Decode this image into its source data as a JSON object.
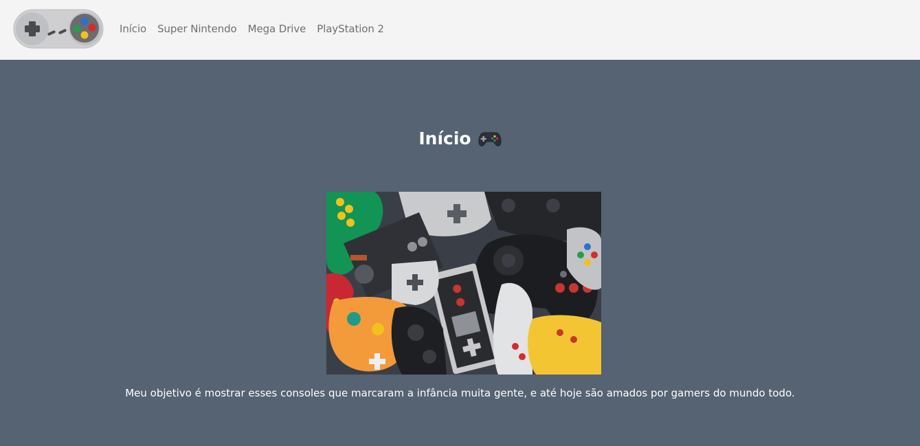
{
  "nav": {
    "items": [
      {
        "label": "Início"
      },
      {
        "label": "Super Nintendo"
      },
      {
        "label": "Mega Drive"
      },
      {
        "label": "PlayStation 2"
      }
    ]
  },
  "main": {
    "title": "Início",
    "title_icon": "gamepad-icon",
    "hero_image": "controllers-collage-image",
    "caption": "Meu objetivo é mostrar esses consoles que marcaram a infância muita gente, e até hoje são amados por gamers do mundo todo."
  },
  "colors": {
    "navbar_bg": "#f4f4f4",
    "page_bg": "#556372",
    "nav_text": "#6c6f73",
    "heading_text": "#ffffff"
  }
}
